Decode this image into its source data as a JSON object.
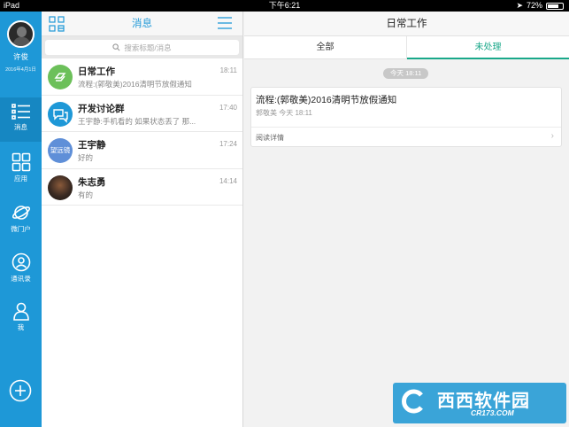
{
  "statusbar": {
    "device": "iPad",
    "time": "下午6:21",
    "battery": "72%",
    "battery_level": 0.72
  },
  "user": {
    "name": "许俊",
    "date": "2016年4月1日"
  },
  "nav": {
    "items": [
      {
        "label": "消息",
        "icon": "message-list-icon"
      },
      {
        "label": "应用",
        "icon": "apps-grid-icon"
      },
      {
        "label": "微门户",
        "icon": "planet-icon"
      },
      {
        "label": "通讯录",
        "icon": "contact-icon"
      },
      {
        "label": "我",
        "icon": "person-icon"
      }
    ],
    "add_icon": "plus-circle-icon"
  },
  "messages": {
    "title": "消息",
    "search_placeholder": "搜索标题/消息",
    "items": [
      {
        "name": "日常工作",
        "preview": "流程:(郭敬美)2016清明节放假通知",
        "time": "18:11",
        "avatar_color": "#6cc05a"
      },
      {
        "name": "开发讨论群",
        "preview": "王宇静:手机看的  如果状态丢了   那...",
        "time": "17:40",
        "avatar_color": "#1e98d7"
      },
      {
        "name": "王宇静",
        "preview": "好的",
        "time": "17:24",
        "avatar_text": "望远镜",
        "avatar_color": "#5f8fd8"
      },
      {
        "name": "朱志勇",
        "preview": "有的",
        "time": "14:14",
        "avatar_color": "#3a2a22"
      }
    ]
  },
  "detail": {
    "title": "日常工作",
    "tabs": [
      {
        "label": "全部"
      },
      {
        "label": "未处理"
      }
    ],
    "active_tab": 1,
    "time_label": "今天 18:11",
    "card": {
      "title": "流程:(郭敬美)2016清明节放假通知",
      "subtitle": "郭敬美 今天 18:11",
      "link": "阅读详情"
    }
  },
  "watermark": {
    "text": "西西软件园",
    "sub": "CR173.COM"
  }
}
